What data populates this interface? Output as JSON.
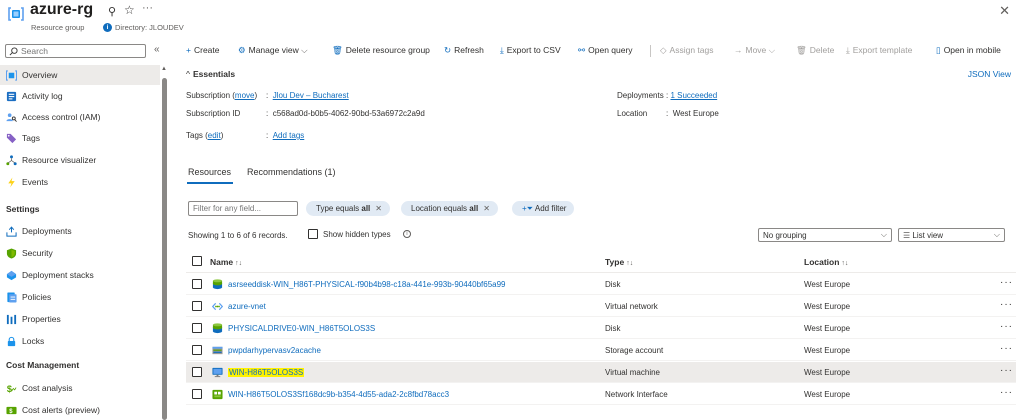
{
  "header": {
    "title": "azure-rg",
    "subtitle": "Resource group",
    "directory": "Directory: JLOUDEV",
    "more": "···"
  },
  "sidebar": {
    "search_placeholder": "Search",
    "items": [
      {
        "label": "Overview",
        "icon": "resource-group-icon"
      },
      {
        "label": "Activity log",
        "icon": "activity-log-icon"
      },
      {
        "label": "Access control (IAM)",
        "icon": "iam-icon"
      },
      {
        "label": "Tags",
        "icon": "tag-icon"
      },
      {
        "label": "Resource visualizer",
        "icon": "visualizer-icon"
      },
      {
        "label": "Events",
        "icon": "lightning-icon"
      }
    ],
    "section_settings": "Settings",
    "settings_items": [
      {
        "label": "Deployments",
        "icon": "deployments-icon"
      },
      {
        "label": "Security",
        "icon": "shield-icon"
      },
      {
        "label": "Deployment stacks",
        "icon": "stack-icon"
      },
      {
        "label": "Policies",
        "icon": "policy-icon"
      },
      {
        "label": "Properties",
        "icon": "properties-icon"
      },
      {
        "label": "Locks",
        "icon": "lock-icon"
      }
    ],
    "section_cost": "Cost Management",
    "cost_items": [
      {
        "label": "Cost analysis",
        "icon": "cost-analysis-icon"
      },
      {
        "label": "Cost alerts (preview)",
        "icon": "cost-alert-icon"
      }
    ]
  },
  "toolbar": {
    "create": "Create",
    "manage_view": "Manage view",
    "delete_rg": "Delete resource group",
    "refresh": "Refresh",
    "export_csv": "Export to CSV",
    "open_query": "Open query",
    "assign_tags": "Assign tags",
    "move": "Move",
    "delete": "Delete",
    "export_template": "Export template",
    "open_mobile": "Open in mobile"
  },
  "essentials": {
    "title": "Essentials",
    "json_view": "JSON View",
    "subscription_label": "Subscription (",
    "move_link": "move",
    "subscription_label_end": ")",
    "subscription_value": "Jlou Dev – Bucharest",
    "subscription_id_label": "Subscription ID",
    "subscription_id_value": "c568ad0d-b0b5-4062-90bd-53a6972c2a9d",
    "tags_label": "Tags (",
    "tags_edit": "edit",
    "tags_label_end": ")",
    "tags_value": "Add tags",
    "deployments_label": "Deployments",
    "deployments_value": "1 Succeeded",
    "location_label": "Location",
    "location_value": "West Europe",
    "colon": ":"
  },
  "tabs": {
    "resources": "Resources",
    "recommendations": "Recommendations (1)"
  },
  "filters": {
    "placeholder": "Filter for any field...",
    "type_prefix": "Type equals",
    "type_value": "all",
    "location_prefix": "Location equals",
    "location_value": "all",
    "add_filter": "Add filter"
  },
  "records": {
    "showing": "Showing 1 to 6 of 6 records.",
    "show_hidden": "Show hidden types",
    "grouping": "No grouping",
    "view": "List view"
  },
  "table": {
    "col_name": "Name",
    "col_type": "Type",
    "col_location": "Location",
    "rows": [
      {
        "name": "asrseeddisk-WIN_H86T-PHYSICAL-f90b4b98-c18a-441e-993b-90440bf65a99",
        "type": "Disk",
        "location": "West Europe",
        "icon": "disk-icon"
      },
      {
        "name": "azure-vnet",
        "type": "Virtual network",
        "location": "West Europe",
        "icon": "vnet-icon"
      },
      {
        "name": "PHYSICALDRIVE0-WIN_H86T5OLOS3S",
        "type": "Disk",
        "location": "West Europe",
        "icon": "disk-icon"
      },
      {
        "name": "pwpdarhypervasv2acache",
        "type": "Storage account",
        "location": "West Europe",
        "icon": "storage-account-icon"
      },
      {
        "name": "WIN-H86T5OLOS3S",
        "type": "Virtual machine",
        "location": "West Europe",
        "icon": "virtual-machine-icon"
      },
      {
        "name": "WIN-H86T5OLOS3Sf168dc9b-b354-4d55-ada2-2c8fbd78acc3",
        "type": "Network Interface",
        "location": "West Europe",
        "icon": "network-interface-icon"
      }
    ],
    "more": "···"
  },
  "colors": {
    "accent": "#0f6cbd",
    "highlight": "#fff200",
    "selected_row": "#edebe9"
  }
}
